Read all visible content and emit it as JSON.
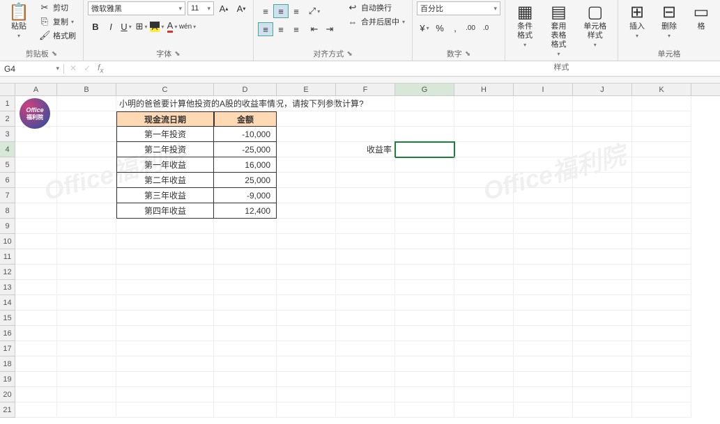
{
  "ribbon": {
    "clipboard": {
      "label": "剪贴板",
      "paste": "粘贴",
      "cut": "剪切",
      "copy": "复制",
      "painter": "格式刷"
    },
    "font": {
      "label": "字体",
      "name": "微软雅黑",
      "size": "11"
    },
    "align": {
      "label": "对齐方式",
      "wrap": "自动换行",
      "merge": "合并后居中"
    },
    "number": {
      "label": "数字",
      "format": "百分比"
    },
    "styles": {
      "label": "样式",
      "cond": "条件格式",
      "table": "套用\n表格格式",
      "cell": "单元格样式"
    },
    "cells": {
      "label": "单元格",
      "insert": "插入",
      "delete": "删除",
      "format": "格"
    }
  },
  "namebox": "G4",
  "formula": "",
  "columns": [
    "A",
    "B",
    "C",
    "D",
    "E",
    "F",
    "G",
    "H",
    "I",
    "J",
    "K"
  ],
  "question": "小明的爸爸要计算他投资的A股的收益率情况，请按下列参数计算?",
  "table": {
    "h1": "现金流日期",
    "h2": "金额",
    "rows": [
      {
        "c": "第一年投资",
        "d": "-10,000"
      },
      {
        "c": "第二年投资",
        "d": "-25,000"
      },
      {
        "c": "第一年收益",
        "d": "16,000"
      },
      {
        "c": "第二年收益",
        "d": "25,000"
      },
      {
        "c": "第三年收益",
        "d": "-9,000"
      },
      {
        "c": "第四年收益",
        "d": "12,400"
      }
    ]
  },
  "label_yield": "收益率",
  "watermark": "Office福利院",
  "logo": {
    "l1": "Office",
    "l2": "福利院"
  }
}
